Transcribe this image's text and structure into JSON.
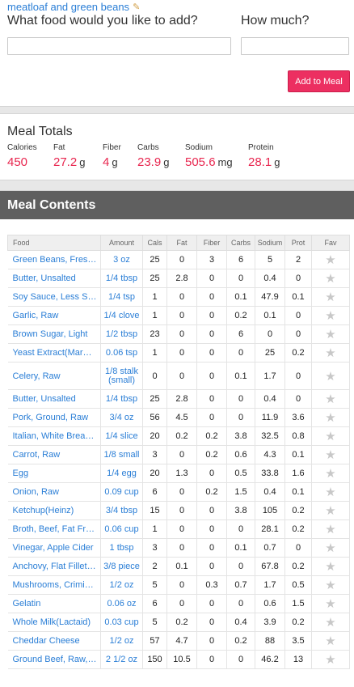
{
  "meal": {
    "name": "meatloaf and green beans",
    "edit_icon": "pencil-icon"
  },
  "add_form": {
    "food_question": "What food would you like to add?",
    "amount_question": "How much?",
    "food_value": "",
    "amount_value": "",
    "add_button": "Add to Meal"
  },
  "totals": {
    "title": "Meal Totals",
    "calories": {
      "label": "Calories",
      "value": "450",
      "unit": ""
    },
    "fat": {
      "label": "Fat",
      "value": "27.2",
      "unit": "g"
    },
    "fiber": {
      "label": "Fiber",
      "value": "4",
      "unit": "g"
    },
    "carbs": {
      "label": "Carbs",
      "value": "23.9",
      "unit": "g"
    },
    "sodium": {
      "label": "Sodium",
      "value": "505.6",
      "unit": "mg"
    },
    "protein": {
      "label": "Protein",
      "value": "28.1",
      "unit": "g"
    }
  },
  "contents": {
    "title": "Meal Contents",
    "columns": [
      "Food",
      "Amount",
      "Cals",
      "Fat",
      "Fiber",
      "Carbs",
      "Sodium",
      "Prot",
      "Fav"
    ],
    "fav_icon": "star-icon",
    "rows": [
      {
        "food": "Green Beans, Fres…",
        "amount": "3 oz",
        "cals": "25",
        "fat": "0",
        "fiber": "3",
        "carbs": "6",
        "sodium": "5",
        "prot": "2"
      },
      {
        "food": "Butter, Unsalted",
        "amount": "1/4 tbsp",
        "cals": "25",
        "fat": "2.8",
        "fiber": "0",
        "carbs": "0",
        "sodium": "0.4",
        "prot": "0"
      },
      {
        "food": "Soy Sauce, Less S…",
        "amount": "1/4 tsp",
        "cals": "1",
        "fat": "0",
        "fiber": "0",
        "carbs": "0.1",
        "sodium": "47.9",
        "prot": "0.1"
      },
      {
        "food": "Garlic, Raw",
        "amount": "1/4 clove",
        "cals": "1",
        "fat": "0",
        "fiber": "0",
        "carbs": "0.2",
        "sodium": "0.1",
        "prot": "0"
      },
      {
        "food": "Brown Sugar, Light",
        "amount": "1/2 tbsp",
        "cals": "23",
        "fat": "0",
        "fiber": "0",
        "carbs": "6",
        "sodium": "0",
        "prot": "0"
      },
      {
        "food": "Yeast Extract(Mar…",
        "amount": "0.06 tsp",
        "cals": "1",
        "fat": "0",
        "fiber": "0",
        "carbs": "0",
        "sodium": "25",
        "prot": "0.2"
      },
      {
        "food": "Celery, Raw",
        "amount": "1/8 stalk (small)",
        "cals": "0",
        "fat": "0",
        "fiber": "0",
        "carbs": "0.1",
        "sodium": "1.7",
        "prot": "0",
        "tall": true
      },
      {
        "food": "Butter, Unsalted",
        "amount": "1/4 tbsp",
        "cals": "25",
        "fat": "2.8",
        "fiber": "0",
        "carbs": "0",
        "sodium": "0.4",
        "prot": "0"
      },
      {
        "food": "Pork, Ground, Raw",
        "amount": "3/4 oz",
        "cals": "56",
        "fat": "4.5",
        "fiber": "0",
        "carbs": "0",
        "sodium": "11.9",
        "prot": "3.6"
      },
      {
        "food": "Italian, White Brea…",
        "amount": "1/4 slice",
        "cals": "20",
        "fat": "0.2",
        "fiber": "0.2",
        "carbs": "3.8",
        "sodium": "32.5",
        "prot": "0.8"
      },
      {
        "food": "Carrot, Raw",
        "amount": "1/8 small",
        "cals": "3",
        "fat": "0",
        "fiber": "0.2",
        "carbs": "0.6",
        "sodium": "4.3",
        "prot": "0.1"
      },
      {
        "food": "Egg",
        "amount": "1/4 egg",
        "cals": "20",
        "fat": "1.3",
        "fiber": "0",
        "carbs": "0.5",
        "sodium": "33.8",
        "prot": "1.6"
      },
      {
        "food": "Onion, Raw",
        "amount": "0.09 cup",
        "cals": "6",
        "fat": "0",
        "fiber": "0.2",
        "carbs": "1.5",
        "sodium": "0.4",
        "prot": "0.1"
      },
      {
        "food": "Ketchup(Heinz)",
        "amount": "3/4 tbsp",
        "cals": "15",
        "fat": "0",
        "fiber": "0",
        "carbs": "3.8",
        "sodium": "105",
        "prot": "0.2"
      },
      {
        "food": "Broth, Beef, Fat Fr…",
        "amount": "0.06 cup",
        "cals": "1",
        "fat": "0",
        "fiber": "0",
        "carbs": "0",
        "sodium": "28.1",
        "prot": "0.2"
      },
      {
        "food": "Vinegar, Apple Cider",
        "amount": "1 tbsp",
        "cals": "3",
        "fat": "0",
        "fiber": "0",
        "carbs": "0.1",
        "sodium": "0.7",
        "prot": "0"
      },
      {
        "food": "Anchovy, Flat Fillet…",
        "amount": "3/8 piece",
        "cals": "2",
        "fat": "0.1",
        "fiber": "0",
        "carbs": "0",
        "sodium": "67.8",
        "prot": "0.2"
      },
      {
        "food": "Mushrooms, Crimi…",
        "amount": "1/2 oz",
        "cals": "5",
        "fat": "0",
        "fiber": "0.3",
        "carbs": "0.7",
        "sodium": "1.7",
        "prot": "0.5"
      },
      {
        "food": "Gelatin",
        "amount": "0.06 oz",
        "cals": "6",
        "fat": "0",
        "fiber": "0",
        "carbs": "0",
        "sodium": "0.6",
        "prot": "1.5"
      },
      {
        "food": "Whole Milk(Lactaid)",
        "amount": "0.03 cup",
        "cals": "5",
        "fat": "0.2",
        "fiber": "0",
        "carbs": "0.4",
        "sodium": "3.9",
        "prot": "0.2"
      },
      {
        "food": "Cheddar Cheese",
        "amount": "1/2 oz",
        "cals": "57",
        "fat": "4.7",
        "fiber": "0",
        "carbs": "0.2",
        "sodium": "88",
        "prot": "3.5"
      },
      {
        "food": "Ground Beef, Raw,…",
        "amount": "2 1/2 oz",
        "cals": "150",
        "fat": "10.5",
        "fiber": "0",
        "carbs": "0",
        "sodium": "46.2",
        "prot": "13"
      }
    ]
  },
  "colors": {
    "link": "#2a7ed6",
    "accent": "#e8264f",
    "button": "#ec2f61",
    "header_bar": "#5f5f5f"
  }
}
